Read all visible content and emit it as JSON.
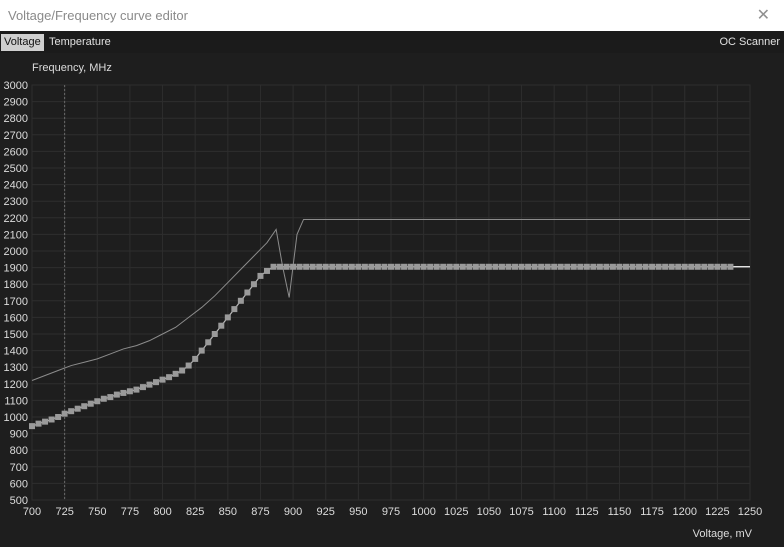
{
  "window": {
    "title": "Voltage/Frequency curve editor"
  },
  "tabs": {
    "voltage": "Voltage",
    "temperature": "Temperature",
    "oc_scanner": "OC Scanner"
  },
  "chart_data": {
    "type": "line",
    "xlabel": "Voltage, mV",
    "ylabel": "Frequency, MHz",
    "xlim": [
      700,
      1250
    ],
    "ylim": [
      500,
      3000
    ],
    "x_ticks": [
      700,
      725,
      750,
      775,
      800,
      825,
      850,
      875,
      900,
      925,
      950,
      975,
      1000,
      1025,
      1050,
      1075,
      1100,
      1125,
      1150,
      1175,
      1200,
      1225,
      1250
    ],
    "y_ticks": [
      500,
      600,
      700,
      800,
      900,
      1000,
      1100,
      1200,
      1300,
      1400,
      1500,
      1600,
      1700,
      1800,
      1900,
      2000,
      2100,
      2200,
      2300,
      2400,
      2500,
      2600,
      2700,
      2800,
      2900,
      3000
    ],
    "cursor_voltage": 725,
    "grid": true,
    "series": [
      {
        "points_x": [
          700,
          705,
          710,
          715,
          720,
          725,
          730,
          735,
          740,
          745,
          750,
          755,
          760,
          765,
          770,
          775,
          780,
          785,
          790,
          795,
          800,
          805,
          810,
          815,
          820,
          825,
          830,
          835,
          840,
          845,
          850,
          855,
          860,
          865,
          870,
          875,
          880,
          885,
          890,
          895,
          900,
          905,
          910,
          915,
          920,
          925,
          930,
          935,
          940,
          945,
          950,
          955,
          960,
          965,
          970,
          975,
          980,
          985,
          990,
          995,
          1000,
          1005,
          1010,
          1015,
          1020,
          1025,
          1030,
          1035,
          1040,
          1045,
          1050,
          1055,
          1060,
          1065,
          1070,
          1075,
          1080,
          1085,
          1090,
          1095,
          1100,
          1105,
          1110,
          1115,
          1120,
          1125,
          1130,
          1135,
          1140,
          1145,
          1150,
          1155,
          1160,
          1165,
          1170,
          1175,
          1180,
          1185,
          1190,
          1195,
          1200,
          1205,
          1210,
          1215,
          1220,
          1225,
          1230,
          1235
        ],
        "points_y": [
          945,
          960,
          972,
          985,
          1000,
          1020,
          1035,
          1050,
          1065,
          1080,
          1095,
          1110,
          1120,
          1135,
          1145,
          1155,
          1165,
          1180,
          1195,
          1210,
          1225,
          1240,
          1260,
          1280,
          1310,
          1350,
          1400,
          1450,
          1500,
          1550,
          1600,
          1650,
          1700,
          1750,
          1800,
          1850,
          1880,
          1905,
          1905,
          1905,
          1905,
          1905,
          1905,
          1905,
          1905,
          1905,
          1905,
          1905,
          1905,
          1905,
          1905,
          1905,
          1905,
          1905,
          1905,
          1905,
          1905,
          1905,
          1905,
          1905,
          1905,
          1905,
          1905,
          1905,
          1905,
          1905,
          1905,
          1905,
          1905,
          1905,
          1905,
          1905,
          1905,
          1905,
          1905,
          1905,
          1905,
          1905,
          1905,
          1905,
          1905,
          1905,
          1905,
          1905,
          1905,
          1905,
          1905,
          1905,
          1905,
          1905,
          1905,
          1905,
          1905,
          1905,
          1905,
          1905,
          1905,
          1905,
          1905,
          1905,
          1905,
          1905,
          1905,
          1905,
          1905,
          1905,
          1905,
          1905
        ]
      },
      {
        "points_x": [
          700,
          710,
          720,
          730,
          740,
          750,
          760,
          770,
          780,
          790,
          800,
          810,
          820,
          830,
          840,
          850,
          860,
          870,
          880,
          887,
          892,
          897,
          903,
          908,
          1250
        ],
        "points_y": [
          1220,
          1250,
          1280,
          1310,
          1330,
          1350,
          1380,
          1410,
          1430,
          1460,
          1500,
          1540,
          1600,
          1660,
          1730,
          1810,
          1890,
          1970,
          2050,
          2130,
          1905,
          1720,
          2100,
          2190,
          2190
        ]
      },
      {
        "points_x": [
          1235,
          1250
        ],
        "points_y": [
          1905,
          1905
        ]
      }
    ]
  },
  "colors": {
    "background": "#1e1e1e",
    "grid": "#2e2e2e",
    "axis_text": "#dcdcdc",
    "curve_points": "#9a9a9a",
    "curve_line": "#b8b8b8",
    "max_line": "#8c8c8c",
    "cursor_line": "#6a6a6a"
  }
}
